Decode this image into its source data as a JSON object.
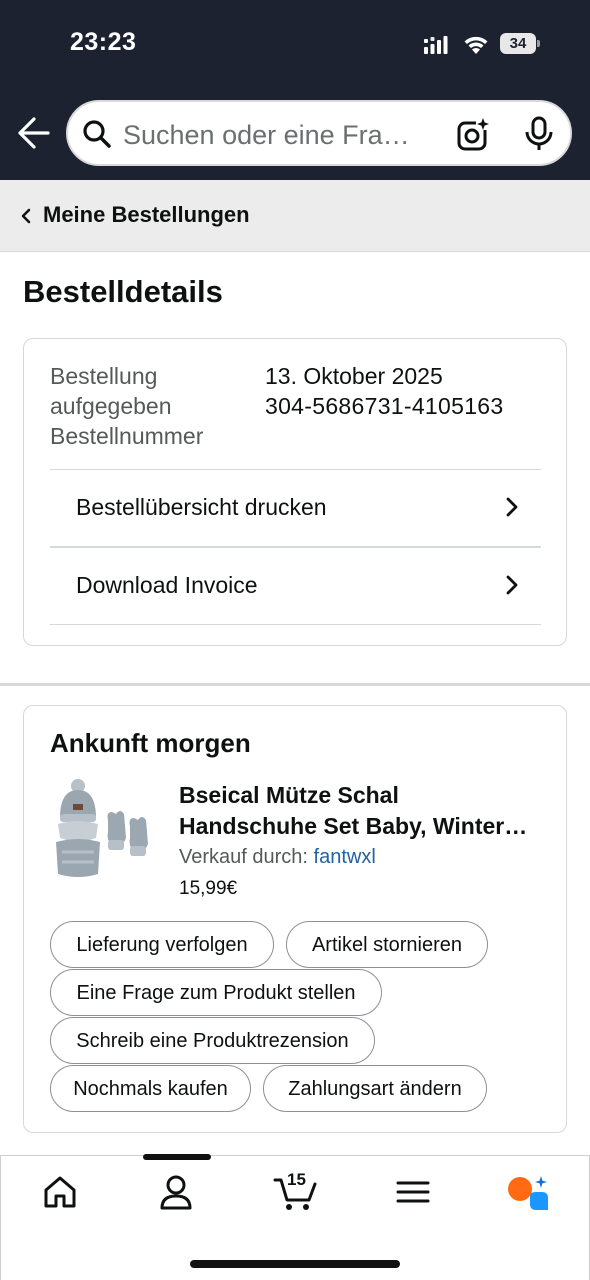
{
  "status_bar": {
    "time": "23:23",
    "battery": "34"
  },
  "search": {
    "placeholder": "Suchen oder eine Fra…"
  },
  "breadcrumb": {
    "label": "Meine Bestellungen"
  },
  "page_title": "Bestelldetails",
  "order": {
    "placed_label": "Bestellung aufgegeben",
    "placed_value": "13. Oktober 2025",
    "number_label": "Bestellnummer",
    "number_value": "304-5686731-4105163",
    "links": [
      {
        "label": "Bestellübersicht drucken"
      },
      {
        "label": "Download Invoice"
      }
    ]
  },
  "shipment": {
    "title": "Ankunft morgen",
    "product": {
      "title_line1": "Bseical Mütze Schal",
      "title_line2": "Handschuhe Set Baby, Winter…",
      "seller_prefix": "Verkauf durch:",
      "seller_name": "fantwxl",
      "price": "15,99€"
    },
    "actions": [
      {
        "label": "Lieferung verfolgen"
      },
      {
        "label": "Artikel stornieren"
      },
      {
        "label": "Eine Frage zum Produkt stellen"
      },
      {
        "label": "Schreib eine Produktrezension"
      },
      {
        "label": "Nochmals kaufen"
      },
      {
        "label": "Zahlungsart ändern"
      }
    ]
  },
  "bottom_nav": {
    "items": [
      "home-icon",
      "account-icon",
      "cart-icon",
      "menu-icon",
      "rufus-icon"
    ],
    "cart_count": "15"
  },
  "colors": {
    "header_bg": "#1c2230",
    "link": "#2162a1",
    "rufus_orange": "#ff6a13",
    "rufus_blue": "#1a98ff"
  }
}
